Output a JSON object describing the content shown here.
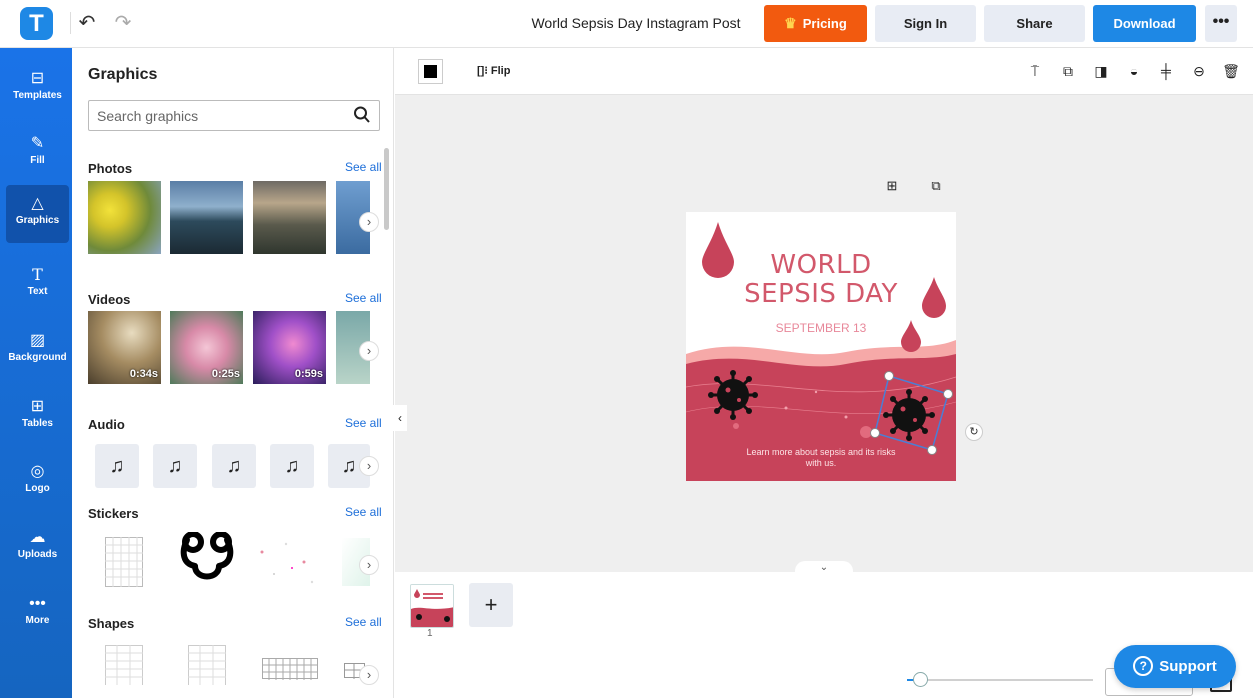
{
  "app": {
    "logo_letter": "T",
    "brand_color": "#1e88e5"
  },
  "header": {
    "undo_icon": "undo-icon",
    "redo_icon": "redo-icon",
    "doc_title": "World Sepsis Day Instagram Post",
    "pricing_label": "Pricing",
    "signin_label": "Sign In",
    "share_label": "Share",
    "download_label": "Download",
    "more_label": "•••"
  },
  "sidebar": {
    "items": [
      {
        "label": "Templates",
        "icon": "templates-icon",
        "glyph": "⊞"
      },
      {
        "label": "Fill",
        "icon": "pen-icon",
        "glyph": "✎"
      },
      {
        "label": "Graphics",
        "icon": "shapes-icon",
        "glyph": "△"
      },
      {
        "label": "Text",
        "icon": "text-icon",
        "glyph": "T"
      },
      {
        "label": "Background",
        "icon": "background-icon",
        "glyph": "▨"
      },
      {
        "label": "Tables",
        "icon": "table-icon",
        "glyph": "⊞"
      },
      {
        "label": "Logo",
        "icon": "logo-icon",
        "glyph": "◎"
      },
      {
        "label": "Uploads",
        "icon": "upload-icon",
        "glyph": "☁"
      },
      {
        "label": "More",
        "icon": "more-icon",
        "glyph": "•••"
      }
    ],
    "active": "Graphics"
  },
  "panel": {
    "title": "Graphics",
    "search_placeholder": "Search graphics",
    "sections": {
      "photos": {
        "title": "Photos",
        "see_all": "See all"
      },
      "videos": {
        "title": "Videos",
        "see_all": "See all",
        "durations": [
          "0:34s",
          "0:25s",
          "0:59s"
        ]
      },
      "audio": {
        "title": "Audio",
        "see_all": "See all"
      },
      "stickers": {
        "title": "Stickers",
        "see_all": "See all"
      },
      "shapes": {
        "title": "Shapes",
        "see_all": "See all"
      }
    }
  },
  "toolbar": {
    "fill_color": "#000000",
    "flip_label": "Flip"
  },
  "artboard": {
    "title_line1": "WORLD",
    "title_line2": "SEPSIS DAY",
    "date": "SEPTEMBER 13",
    "footer": "Learn more about sepsis and its risks with us.",
    "accent": "#c7435a"
  },
  "pages": {
    "current_number": "1"
  },
  "support": {
    "label": "Support"
  }
}
